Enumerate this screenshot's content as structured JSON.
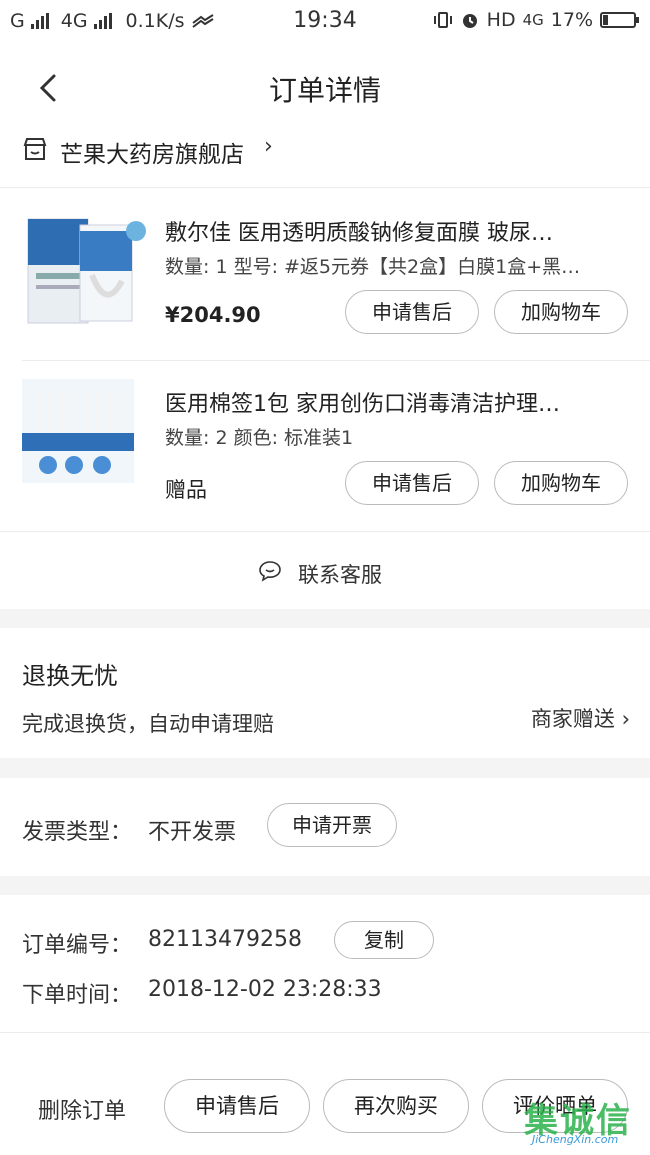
{
  "statusbar": {
    "carrier": "G",
    "network1": "4G",
    "speed": "0.1K/s",
    "time": "19:34",
    "hd": "HD",
    "network2": "4G",
    "battery_text": "17%",
    "battery_level": 0.17
  },
  "navbar": {
    "title": "订单详情"
  },
  "store": {
    "name": "芒果大药房旗舰店",
    "chevron": "›"
  },
  "items": [
    {
      "name": "敷尔佳 医用透明质酸钠修复面膜 玻尿…",
      "spec": "数量: 1 型号: #返5元券【共2盒】白膜1盒+黑…",
      "price": "¥204.90",
      "btn_after_sale": "申请售后",
      "btn_add_cart": "加购物车"
    },
    {
      "name": "医用棉签1包 家用创伤口消毒清洁护理…",
      "spec": "数量: 2 颜色: 标准装1",
      "gift": "赠品",
      "btn_after_sale": "申请售后",
      "btn_add_cart": "加购物车"
    }
  ],
  "service": {
    "label": "联系客服"
  },
  "return": {
    "title": "退换无忧",
    "desc": "完成退换货，自动申请理赔",
    "gift_link": "商家赠送 ›"
  },
  "invoice": {
    "label": "发票类型：",
    "value": "不开发票",
    "btn": "申请开票"
  },
  "order": {
    "no_label": "订单编号：",
    "no_value": "82113479258",
    "copy_btn": "复制",
    "time_label": "下单时间：",
    "time_value": "2018-12-02 23:28:33"
  },
  "bottom": {
    "delete": "删除订单",
    "after_sale": "申请售后",
    "rebuy": "再次购买",
    "review": "评价晒单"
  },
  "watermark": {
    "text": "集诚信",
    "sub": "JiChengXin.com"
  }
}
